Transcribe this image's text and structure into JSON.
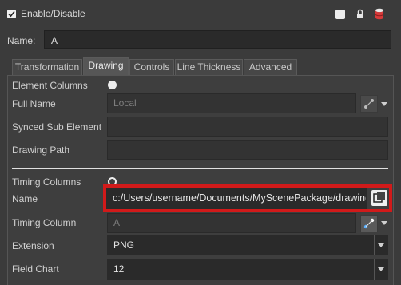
{
  "header": {
    "enable_label": "Enable/Disable",
    "enabled": true
  },
  "name_row": {
    "label": "Name:",
    "value": "A"
  },
  "tabs": [
    {
      "label": "Transformation",
      "active": false
    },
    {
      "label": "Drawing",
      "active": true
    },
    {
      "label": "Controls",
      "active": false
    },
    {
      "label": "Line Thickness",
      "active": false
    },
    {
      "label": "Advanced",
      "active": false
    }
  ],
  "drawing": {
    "element_columns": {
      "label": "Element Columns"
    },
    "full_name": {
      "label": "Full Name",
      "value": "Local"
    },
    "synced_sub_element": {
      "label": "Synced Sub Element",
      "value": ""
    },
    "drawing_path": {
      "label": "Drawing Path",
      "value": ""
    },
    "timing_columns": {
      "label": "Timing Columns"
    },
    "name": {
      "label": "Name",
      "value": "c:/Users/username/Documents/MyScenePackage/drawings/A/A"
    },
    "timing_column": {
      "label": "Timing Column",
      "value": "A"
    },
    "extension": {
      "label": "Extension",
      "value": "PNG"
    },
    "field_chart": {
      "label": "Field Chart",
      "value": "12"
    }
  },
  "colors": {
    "highlight": "#d11a1a",
    "background": "#3b3b3b"
  }
}
